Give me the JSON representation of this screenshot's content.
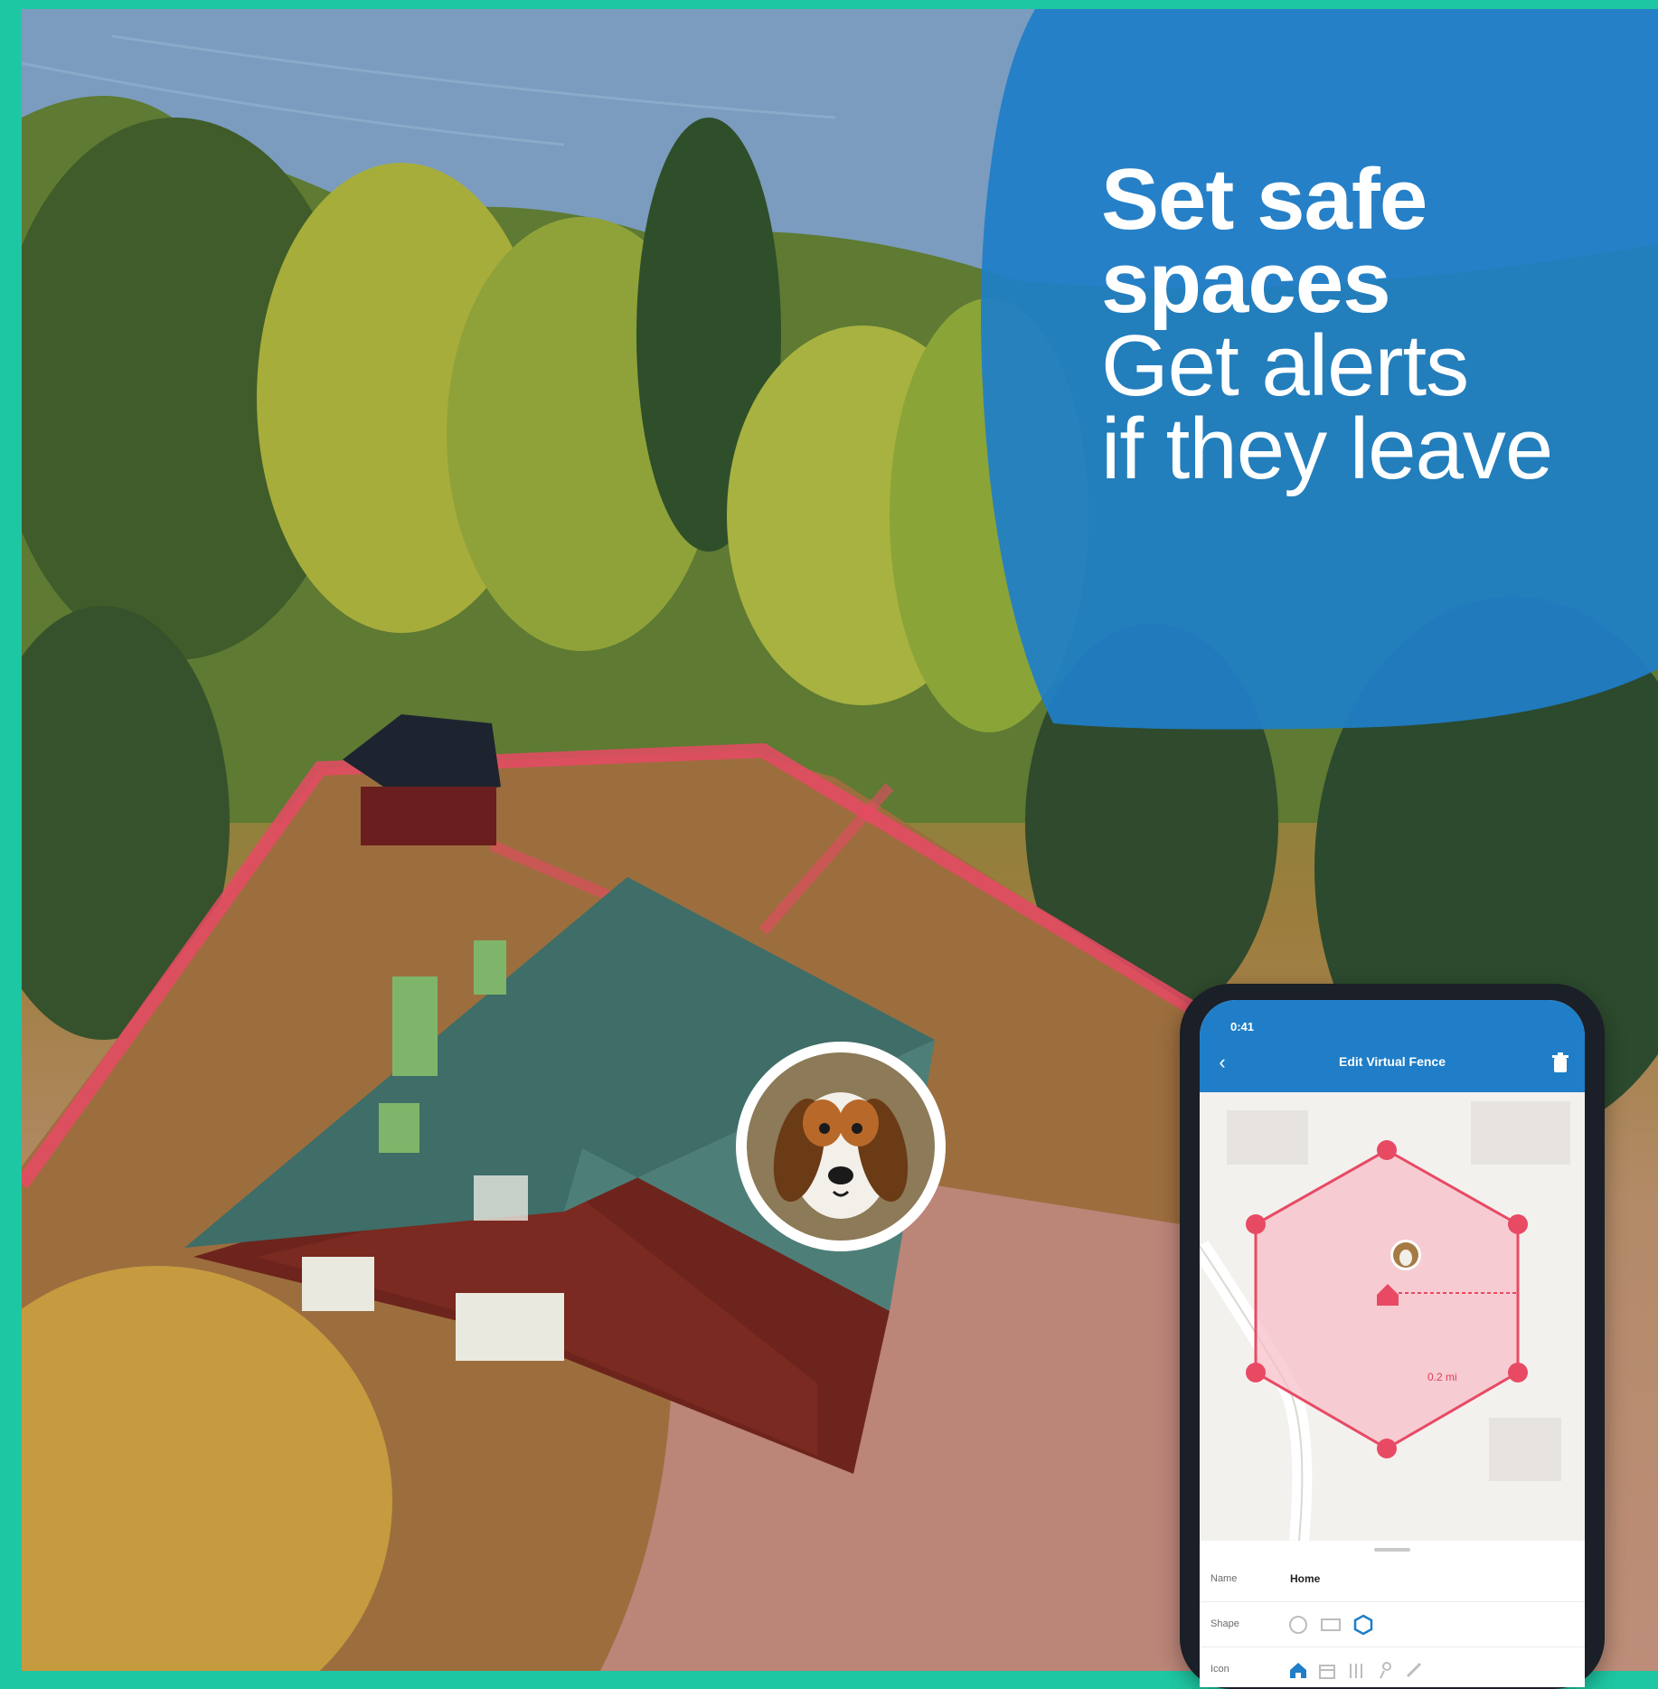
{
  "headline": {
    "line1": "Set safe",
    "line2": "spaces",
    "line3": "Get alerts",
    "line4": "if they leave"
  },
  "colors": {
    "frame": "#1ec7a3",
    "blob": "#1f7ec7",
    "fence": "#e84a64",
    "app_header": "#1f7ec7"
  },
  "phone": {
    "status_time": "0:41",
    "title": "Edit Virtual Fence",
    "back_icon": "chevron-left-icon",
    "delete_icon": "trash-icon",
    "distance": "0.2 mi",
    "rows": {
      "name_label": "Name",
      "name_value": "Home",
      "shape_label": "Shape",
      "icon_label": "Icon"
    },
    "shape_options": [
      "circle-shape-icon",
      "rectangle-shape-icon",
      "polygon-shape-icon"
    ],
    "shape_selected": "polygon-shape-icon",
    "icon_options": [
      "home-icon",
      "building-icon",
      "fence-icon",
      "tree-icon",
      "tool-icon"
    ],
    "icon_selected": "home-icon"
  }
}
